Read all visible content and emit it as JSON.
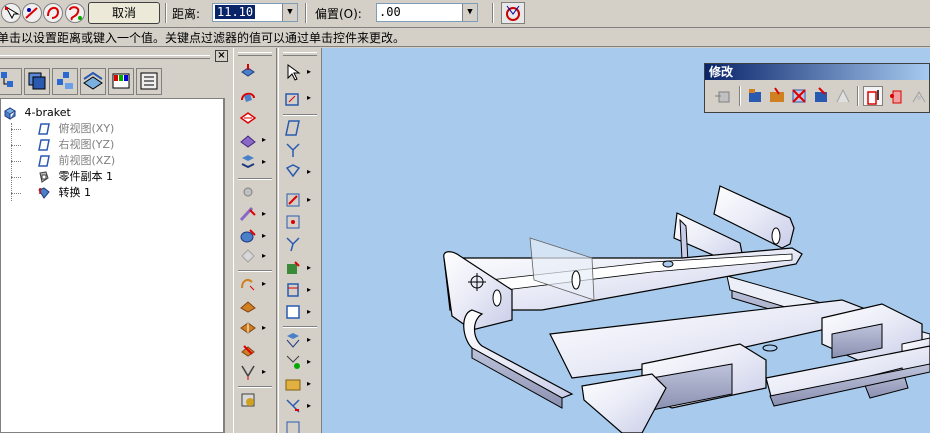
{
  "toolbar": {
    "cancel_label": "取消",
    "distance_label": "距离:",
    "distance_value": "11.10",
    "offset_label": "偏置(O):",
    "offset_value": ".00"
  },
  "prompt": {
    "text": "单击以设置距离或键入一个值。关键点过滤器的值可以通过单击控件来更改。"
  },
  "tree": {
    "root": "4-braket",
    "items": [
      {
        "label": "俯视图(XY)",
        "icon": "plane-icon",
        "dimmed": true
      },
      {
        "label": "右视图(YZ)",
        "icon": "plane-icon",
        "dimmed": true
      },
      {
        "label": "前视图(XZ)",
        "icon": "plane-icon",
        "dimmed": true
      },
      {
        "label": "零件副本 1",
        "icon": "part-copy-icon",
        "dimmed": false
      },
      {
        "label": "转换 1",
        "icon": "transform-icon",
        "dimmed": false
      }
    ]
  },
  "modify_toolbar": {
    "title": "修改"
  },
  "colors": {
    "viewport_bg": "#a8cbed",
    "title_blue": "#0a246a",
    "selection": "#0a246a"
  }
}
